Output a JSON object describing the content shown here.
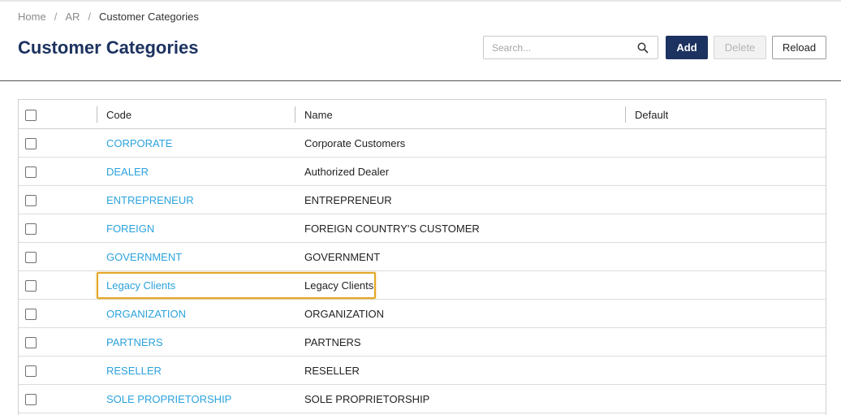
{
  "breadcrumb": {
    "home": "Home",
    "module": "AR",
    "current": "Customer Categories"
  },
  "page_title": "Customer Categories",
  "search": {
    "placeholder": "Search..."
  },
  "toolbar": {
    "add_label": "Add",
    "delete_label": "Delete",
    "reload_label": "Reload"
  },
  "table": {
    "columns": {
      "code": "Code",
      "name": "Name",
      "default": "Default"
    },
    "rows": [
      {
        "code": "CORPORATE",
        "name": "Corporate Customers",
        "default": ""
      },
      {
        "code": "DEALER",
        "name": "Authorized Dealer",
        "default": ""
      },
      {
        "code": "ENTREPRENEUR",
        "name": "ENTREPRENEUR",
        "default": ""
      },
      {
        "code": "FOREIGN",
        "name": "FOREIGN COUNTRY'S CUSTOMER",
        "default": ""
      },
      {
        "code": "GOVERNMENT",
        "name": "GOVERNMENT",
        "default": ""
      },
      {
        "code": "Legacy Clients",
        "name": "Legacy Clients",
        "default": "",
        "highlighted": true
      },
      {
        "code": "ORGANIZATION",
        "name": "ORGANIZATION",
        "default": ""
      },
      {
        "code": "PARTNERS",
        "name": "PARTNERS",
        "default": ""
      },
      {
        "code": "RESELLER",
        "name": "RESELLER",
        "default": ""
      },
      {
        "code": "SOLE PROPRIETORSHIP",
        "name": "SOLE PROPRIETORSHIP",
        "default": ""
      }
    ]
  },
  "colors": {
    "title": "#1c3260",
    "primary_button": "#1c3260",
    "link": "#2ba2dc",
    "highlight": "#e3a724"
  },
  "icons": {
    "search": "search-icon"
  }
}
